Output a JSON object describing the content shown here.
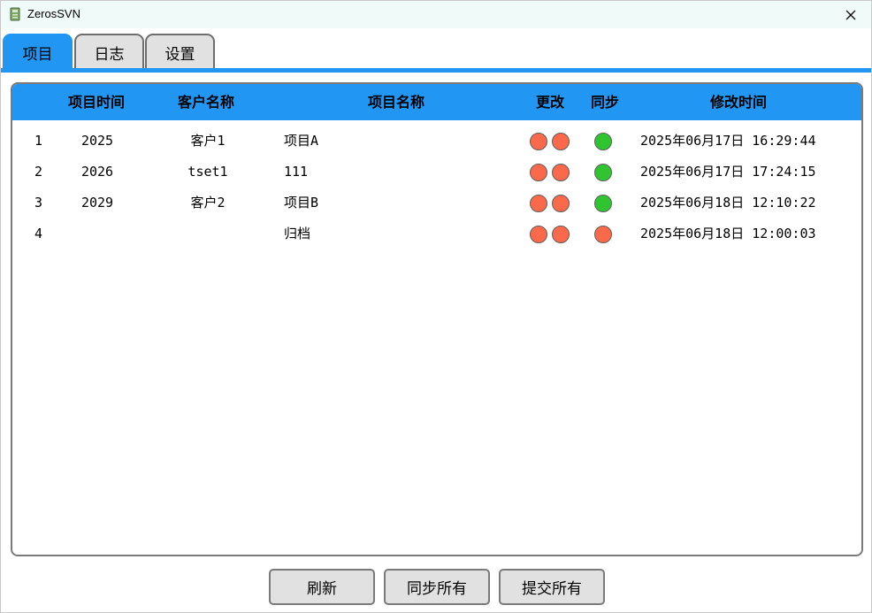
{
  "window": {
    "title": "ZerosSVN"
  },
  "tabs": [
    {
      "label": "项目",
      "active": true
    },
    {
      "label": "日志",
      "active": false
    },
    {
      "label": "设置",
      "active": false
    }
  ],
  "table": {
    "headers": {
      "project_time": "项目时间",
      "client_name": "客户名称",
      "project_name": "项目名称",
      "changes": "更改",
      "sync": "同步",
      "modified_time": "修改时间"
    },
    "rows": [
      {
        "index": "1",
        "project_time": "2025",
        "client_name": "客户1",
        "project_name": "项目A",
        "changes": [
          "red",
          "red"
        ],
        "sync": "green",
        "modified_time": "2025年06月17日 16:29:44"
      },
      {
        "index": "2",
        "project_time": "2026",
        "client_name": "tset1",
        "project_name": "111",
        "changes": [
          "red",
          "red"
        ],
        "sync": "green",
        "modified_time": "2025年06月17日 17:24:15"
      },
      {
        "index": "3",
        "project_time": "2029",
        "client_name": "客户2",
        "project_name": "项目B",
        "changes": [
          "red",
          "red"
        ],
        "sync": "green",
        "modified_time": "2025年06月18日 12:10:22"
      },
      {
        "index": "4",
        "project_time": "",
        "client_name": "",
        "project_name": "归档",
        "changes": [
          "red",
          "red"
        ],
        "sync": "red",
        "modified_time": "2025年06月18日 12:00:03"
      }
    ]
  },
  "colors": {
    "accent": "#2196f3",
    "red": "#f9694a",
    "green": "#31c431"
  },
  "buttons": {
    "refresh": "刷新",
    "sync_all": "同步所有",
    "commit_all": "提交所有"
  }
}
